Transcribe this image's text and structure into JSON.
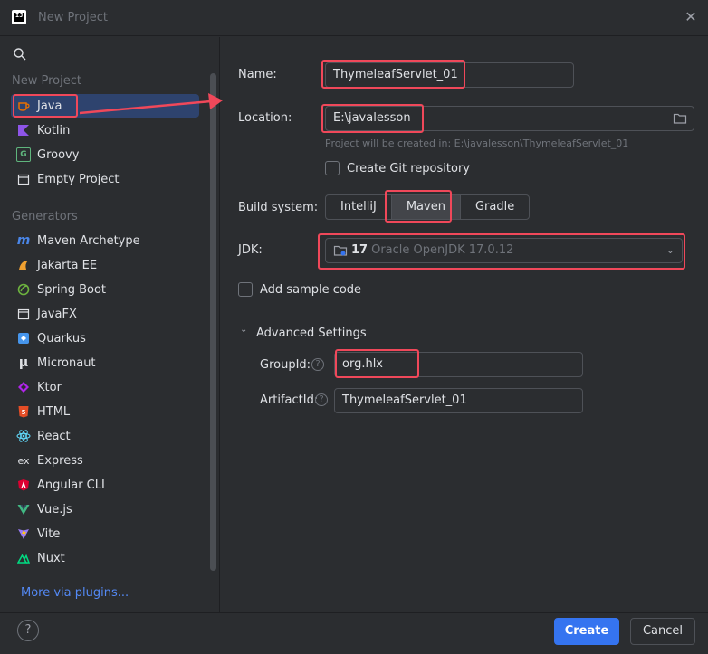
{
  "window": {
    "title": "New Project"
  },
  "sidebar": {
    "new_project_title": "New Project",
    "generators_title": "Generators",
    "new_project_items": [
      {
        "label": "Java",
        "icon": "java-cup-icon"
      },
      {
        "label": "Kotlin",
        "icon": "kotlin-icon"
      },
      {
        "label": "Groovy",
        "icon": "groovy-icon"
      },
      {
        "label": "Empty Project",
        "icon": "folder-icon"
      }
    ],
    "generator_items": [
      {
        "label": "Maven Archetype",
        "icon": "maven-icon"
      },
      {
        "label": "Jakarta EE",
        "icon": "jakarta-icon"
      },
      {
        "label": "Spring Boot",
        "icon": "spring-icon"
      },
      {
        "label": "JavaFX",
        "icon": "javafx-icon"
      },
      {
        "label": "Quarkus",
        "icon": "quarkus-icon"
      },
      {
        "label": "Micronaut",
        "icon": "micronaut-icon"
      },
      {
        "label": "Ktor",
        "icon": "ktor-icon"
      },
      {
        "label": "HTML",
        "icon": "html5-icon"
      },
      {
        "label": "React",
        "icon": "react-icon"
      },
      {
        "label": "Express",
        "icon": "express-icon"
      },
      {
        "label": "Angular CLI",
        "icon": "angular-icon"
      },
      {
        "label": "Vue.js",
        "icon": "vue-icon"
      },
      {
        "label": "Vite",
        "icon": "vite-icon"
      },
      {
        "label": "Nuxt",
        "icon": "nuxt-icon"
      }
    ],
    "more_plugins": "More via plugins..."
  },
  "form": {
    "name_label": "Name:",
    "name_value": "ThymeleafServlet_01",
    "location_label": "Location:",
    "location_value": "E:\\javalesson",
    "location_hint": "Project will be created in: E:\\javalesson\\ThymeleafServlet_01",
    "git_label": "Create Git repository",
    "build_label": "Build system:",
    "build_options": [
      "IntelliJ",
      "Maven",
      "Gradle"
    ],
    "build_selected": "Maven",
    "jdk_label": "JDK:",
    "jdk_version": "17",
    "jdk_name": "Oracle OpenJDK 17.0.12",
    "sample_label": "Add sample code",
    "advanced_label": "Advanced Settings",
    "groupid_label": "GroupId:",
    "groupid_value": "org.hlx",
    "artifactid_label": "ArtifactId:",
    "artifactid_value": "ThymeleafServlet_01"
  },
  "footer": {
    "help": "?",
    "create": "Create",
    "cancel": "Cancel"
  },
  "colors": {
    "accent": "#3574f0",
    "highlight": "#f0485a",
    "selection": "#2e436e"
  }
}
